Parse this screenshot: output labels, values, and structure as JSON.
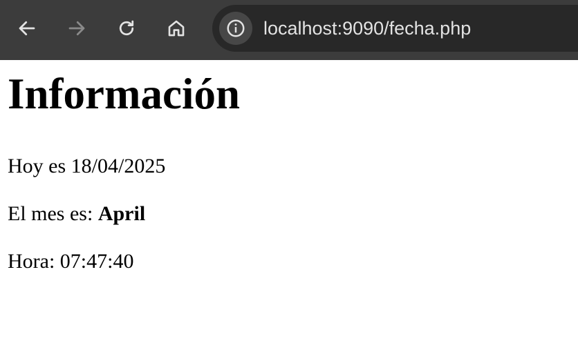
{
  "browser": {
    "url": "localhost:9090/fecha.php"
  },
  "page": {
    "title": "Información",
    "date_line": "Hoy es 18/04/2025",
    "month_label": "El mes es: ",
    "month_value": "April",
    "time_line": "Hora: 07:47:40"
  },
  "icons": {
    "back": "arrow-left-icon",
    "forward": "arrow-right-icon",
    "reload": "reload-icon",
    "home": "home-icon",
    "site_info": "info-icon"
  },
  "colors": {
    "toolbar_bg": "#3c3c3c",
    "omnibox_bg": "#282828",
    "icon_active": "#e3e3e3",
    "icon_disabled": "#8a8a8a",
    "page_bg": "#ffffff",
    "text": "#000000"
  }
}
